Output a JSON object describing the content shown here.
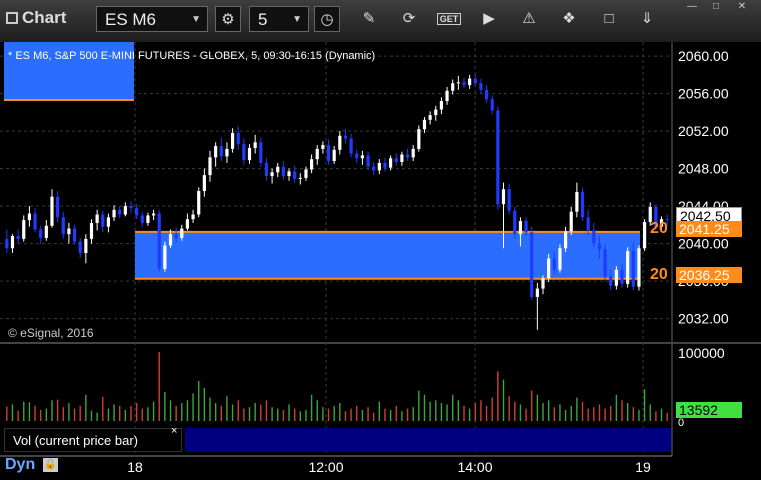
{
  "toolbar": {
    "app_title": "Chart",
    "symbol": "ES M6",
    "interval": "5",
    "icons": [
      "chart-icon",
      "chevron-down-icon",
      "gear-icon",
      "chevron-down-icon",
      "clock-icon",
      "pencil-icon",
      "refresh-icon",
      "get-icon",
      "play-icon",
      "alert-icon",
      "tools-icon",
      "chat-icon",
      "pin-icon"
    ]
  },
  "window": {
    "minimize": "—",
    "restore": "□",
    "close": "✕"
  },
  "chart": {
    "header": "* ES M6, S&P 500 E-MINI FUTURES - GLOBEX, 5, 09:30-16:15 (Dynamic)",
    "copyright": "© eSignal, 2016",
    "price_axis": [
      "2060.00",
      "2056.00",
      "2052.00",
      "2048.00",
      "2044.00",
      "2040.00",
      "2036.00",
      "2032.00"
    ],
    "last_price": "2042.50",
    "zone_upper_price": "2041.25",
    "zone_lower_price": "2036.25",
    "zone_upper_label": "20",
    "zone_lower_label": "20",
    "colors": {
      "zone": "#2a6dff",
      "zone_line": "#ff8c1a",
      "up": "#ffffff",
      "down": "#1e3cff",
      "background": "#000000"
    }
  },
  "volume": {
    "axis_top": "100000",
    "axis_zero": "0",
    "last_volume": "13592",
    "legend": "Vol (current price bar)",
    "close": "×",
    "colors": {
      "up": "#3aa83a",
      "down": "#d04030",
      "last_tag": "#40e040"
    }
  },
  "time_axis": [
    "18",
    "12:00",
    "14:00",
    "19"
  ],
  "footer": {
    "dyn": "Dyn",
    "dyn_icon": "lock-icon"
  },
  "chart_data": {
    "type": "candlestick",
    "ylim": [
      2029.5,
      2061.5
    ],
    "y_ticks": [
      2060,
      2056,
      2052,
      2048,
      2044,
      2040,
      2036,
      2032
    ],
    "zone": [
      2036.25,
      2041.25
    ],
    "candles": [
      [
        2040.5,
        2041.5,
        2039.0,
        2039.5
      ],
      [
        2039.5,
        2041.0,
        2039.0,
        2040.8
      ],
      [
        2040.8,
        2041.5,
        2040.0,
        2040.5
      ],
      [
        2040.5,
        2043.0,
        2040.2,
        2042.5
      ],
      [
        2042.5,
        2044.0,
        2041.8,
        2043.2
      ],
      [
        2043.2,
        2043.8,
        2041.2,
        2041.5
      ],
      [
        2041.5,
        2041.9,
        2040.0,
        2040.6
      ],
      [
        2040.6,
        2042.5,
        2040.3,
        2041.9
      ],
      [
        2041.9,
        2045.8,
        2041.7,
        2045.0
      ],
      [
        2045.0,
        2045.6,
        2042.3,
        2042.8
      ],
      [
        2042.8,
        2043.4,
        2040.5,
        2041.0
      ],
      [
        2041.0,
        2042.2,
        2040.0,
        2041.6
      ],
      [
        2041.6,
        2042.0,
        2039.9,
        2040.2
      ],
      [
        2040.2,
        2040.6,
        2038.5,
        2039.0
      ],
      [
        2039.0,
        2041.0,
        2037.9,
        2040.5
      ],
      [
        2040.5,
        2042.6,
        2040.0,
        2042.2
      ],
      [
        2042.2,
        2043.6,
        2041.4,
        2043.1
      ],
      [
        2043.1,
        2043.5,
        2041.2,
        2041.8
      ],
      [
        2041.8,
        2043.2,
        2041.2,
        2042.8
      ],
      [
        2042.8,
        2044.1,
        2042.4,
        2043.6
      ],
      [
        2043.6,
        2044.0,
        2042.7,
        2043.1
      ],
      [
        2043.1,
        2044.4,
        2042.9,
        2044.0
      ],
      [
        2044.0,
        2044.5,
        2043.3,
        2043.8
      ],
      [
        2043.8,
        2044.2,
        2042.6,
        2043.0
      ],
      [
        2043.0,
        2043.4,
        2041.8,
        2042.2
      ],
      [
        2042.2,
        2043.3,
        2041.9,
        2043.0
      ],
      [
        2043.0,
        2043.6,
        2042.5,
        2043.2
      ],
      [
        2043.2,
        2043.6,
        2037.0,
        2037.3
      ],
      [
        2037.3,
        2040.2,
        2037.0,
        2039.8
      ],
      [
        2039.8,
        2041.5,
        2039.5,
        2041.0
      ],
      [
        2041.0,
        2041.7,
        2040.1,
        2040.6
      ],
      [
        2040.6,
        2042.0,
        2040.3,
        2041.6
      ],
      [
        2041.6,
        2043.2,
        2041.4,
        2042.6
      ],
      [
        2042.6,
        2043.6,
        2042.2,
        2043.1
      ],
      [
        2043.1,
        2046.0,
        2042.8,
        2045.6
      ],
      [
        2045.6,
        2048.0,
        2045.0,
        2047.3
      ],
      [
        2047.3,
        2049.9,
        2046.6,
        2049.2
      ],
      [
        2049.2,
        2050.8,
        2048.2,
        2050.4
      ],
      [
        2050.4,
        2051.3,
        2048.8,
        2049.3
      ],
      [
        2049.3,
        2050.8,
        2048.6,
        2050.1
      ],
      [
        2050.1,
        2052.3,
        2049.7,
        2051.8
      ],
      [
        2051.8,
        2052.5,
        2050.0,
        2050.6
      ],
      [
        2050.6,
        2051.2,
        2048.4,
        2048.9
      ],
      [
        2048.9,
        2050.6,
        2048.5,
        2050.2
      ],
      [
        2050.2,
        2051.6,
        2049.6,
        2050.8
      ],
      [
        2050.8,
        2051.3,
        2048.2,
        2048.6
      ],
      [
        2048.6,
        2049.1,
        2046.7,
        2047.2
      ],
      [
        2047.2,
        2048.0,
        2046.4,
        2047.6
      ],
      [
        2047.6,
        2048.6,
        2047.1,
        2048.2
      ],
      [
        2048.2,
        2048.8,
        2046.8,
        2047.2
      ],
      [
        2047.2,
        2048.0,
        2046.7,
        2047.7
      ],
      [
        2047.7,
        2048.3,
        2046.5,
        2046.9
      ],
      [
        2046.9,
        2047.5,
        2046.3,
        2047.0
      ],
      [
        2047.0,
        2048.2,
        2046.7,
        2047.9
      ],
      [
        2047.9,
        2049.5,
        2047.5,
        2049.0
      ],
      [
        2049.0,
        2050.5,
        2048.4,
        2050.1
      ],
      [
        2050.1,
        2050.9,
        2049.6,
        2050.5
      ],
      [
        2050.5,
        2051.1,
        2048.4,
        2048.8
      ],
      [
        2048.8,
        2050.4,
        2048.5,
        2050.0
      ],
      [
        2050.0,
        2052.0,
        2049.5,
        2051.5
      ],
      [
        2051.5,
        2052.2,
        2050.7,
        2051.2
      ],
      [
        2051.2,
        2051.7,
        2049.2,
        2049.6
      ],
      [
        2049.6,
        2050.0,
        2048.6,
        2049.1
      ],
      [
        2049.1,
        2049.9,
        2048.4,
        2049.4
      ],
      [
        2049.4,
        2049.8,
        2047.8,
        2048.2
      ],
      [
        2048.2,
        2048.7,
        2047.3,
        2047.8
      ],
      [
        2047.8,
        2049.0,
        2047.4,
        2048.6
      ],
      [
        2048.6,
        2049.1,
        2047.7,
        2048.1
      ],
      [
        2048.1,
        2049.4,
        2047.8,
        2049.1
      ],
      [
        2049.1,
        2049.6,
        2048.3,
        2048.7
      ],
      [
        2048.7,
        2049.8,
        2048.3,
        2049.5
      ],
      [
        2049.5,
        2050.1,
        2048.8,
        2049.2
      ],
      [
        2049.2,
        2050.5,
        2048.8,
        2050.1
      ],
      [
        2050.1,
        2052.6,
        2049.8,
        2052.2
      ],
      [
        2052.2,
        2053.5,
        2051.8,
        2053.2
      ],
      [
        2053.2,
        2054.1,
        2052.7,
        2053.7
      ],
      [
        2053.7,
        2054.7,
        2053.1,
        2054.3
      ],
      [
        2054.3,
        2055.6,
        2053.8,
        2055.2
      ],
      [
        2055.2,
        2056.7,
        2054.8,
        2056.3
      ],
      [
        2056.3,
        2057.5,
        2055.9,
        2057.1
      ],
      [
        2057.1,
        2057.9,
        2056.4,
        2057.2
      ],
      [
        2057.2,
        2057.7,
        2056.6,
        2056.9
      ],
      [
        2056.9,
        2058.0,
        2056.5,
        2057.6
      ],
      [
        2057.6,
        2058.1,
        2056.8,
        2057.1
      ],
      [
        2057.1,
        2057.6,
        2056.0,
        2056.4
      ],
      [
        2056.4,
        2056.9,
        2055.0,
        2055.4
      ],
      [
        2055.4,
        2055.8,
        2053.8,
        2054.2
      ],
      [
        2054.2,
        2054.6,
        2043.6,
        2044.2
      ],
      [
        2044.2,
        2046.5,
        2039.5,
        2045.8
      ],
      [
        2045.8,
        2046.4,
        2043.1,
        2043.5
      ],
      [
        2043.5,
        2043.9,
        2040.6,
        2041.0
      ],
      [
        2041.0,
        2042.8,
        2039.7,
        2042.4
      ],
      [
        2042.4,
        2042.8,
        2040.8,
        2041.2
      ],
      [
        2041.2,
        2041.8,
        2034.0,
        2034.3
      ],
      [
        2034.3,
        2035.8,
        2030.8,
        2035.2
      ],
      [
        2035.2,
        2036.6,
        2034.6,
        2036.3
      ],
      [
        2036.3,
        2038.9,
        2035.9,
        2038.4
      ],
      [
        2038.4,
        2039.2,
        2036.8,
        2037.2
      ],
      [
        2037.2,
        2039.9,
        2036.9,
        2039.5
      ],
      [
        2039.5,
        2041.8,
        2039.1,
        2041.3
      ],
      [
        2041.3,
        2043.9,
        2040.9,
        2043.4
      ],
      [
        2043.4,
        2046.5,
        2042.8,
        2045.5
      ],
      [
        2045.5,
        2046.0,
        2042.4,
        2042.8
      ],
      [
        2042.8,
        2043.6,
        2041.0,
        2041.4
      ],
      [
        2041.4,
        2042.2,
        2039.6,
        2040.0
      ],
      [
        2040.0,
        2040.8,
        2038.4,
        2039.4
      ],
      [
        2039.4,
        2039.9,
        2036.0,
        2036.5
      ],
      [
        2036.5,
        2037.2,
        2035.0,
        2035.5
      ],
      [
        2035.5,
        2037.6,
        2035.1,
        2037.2
      ],
      [
        2037.2,
        2037.8,
        2035.3,
        2035.7
      ],
      [
        2035.7,
        2039.6,
        2035.3,
        2039.2
      ],
      [
        2039.2,
        2040.2,
        2035.0,
        2035.4
      ],
      [
        2035.4,
        2039.8,
        2035.0,
        2039.5
      ],
      [
        2039.5,
        2042.6,
        2039.2,
        2042.3
      ],
      [
        2042.3,
        2044.4,
        2041.9,
        2043.9
      ],
      [
        2043.9,
        2044.2,
        2041.4,
        2041.8
      ],
      [
        2041.8,
        2042.9,
        2041.4,
        2042.6
      ],
      [
        2042.6,
        2043.1,
        2041.9,
        2042.5
      ]
    ],
    "volumes": [
      21,
      24,
      15,
      28,
      27,
      22,
      16,
      18,
      30,
      31,
      20,
      26,
      18,
      22,
      38,
      15,
      12,
      35,
      18,
      24,
      22,
      16,
      22,
      26,
      18,
      20,
      28,
      100,
      42,
      30,
      22,
      26,
      30,
      40,
      58,
      48,
      34,
      26,
      22,
      36,
      24,
      30,
      18,
      20,
      26,
      24,
      30,
      20,
      18,
      16,
      24,
      18,
      14,
      16,
      38,
      30,
      20,
      18,
      22,
      26,
      14,
      18,
      22,
      16,
      20,
      12,
      28,
      18,
      16,
      22,
      14,
      18,
      20,
      44,
      38,
      28,
      30,
      26,
      24,
      38,
      30,
      22,
      18,
      26,
      30,
      22,
      34,
      72,
      60,
      36,
      28,
      24,
      18,
      44,
      38,
      26,
      30,
      20,
      24,
      16,
      22,
      34,
      28,
      18,
      20,
      24,
      18,
      22,
      38,
      30,
      26,
      20,
      16,
      46,
      24,
      14,
      18,
      12
    ]
  }
}
